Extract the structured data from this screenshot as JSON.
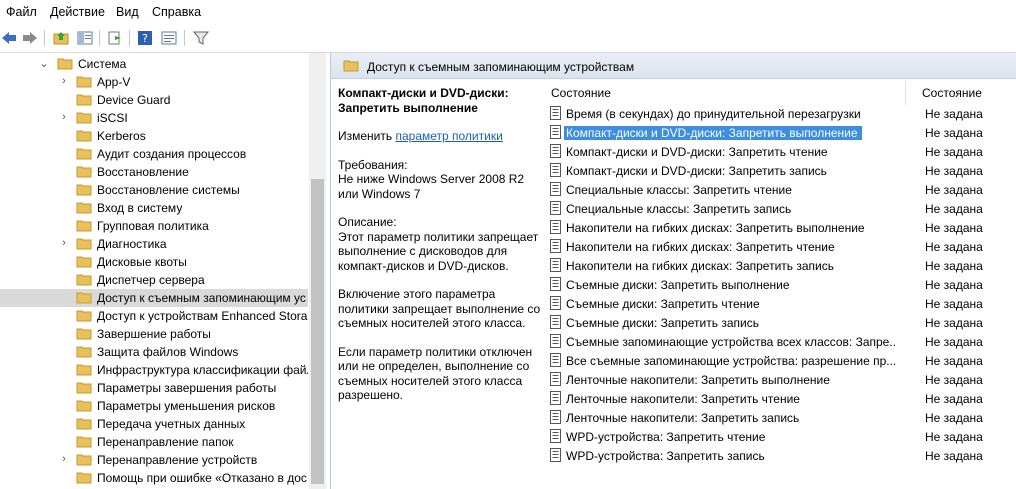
{
  "menu": [
    "Файл",
    "Действие",
    "Вид",
    "Справка"
  ],
  "tree": {
    "root": "Система",
    "items": [
      {
        "label": "App-V",
        "expandable": true
      },
      {
        "label": "Device Guard",
        "expandable": false
      },
      {
        "label": "iSCSI",
        "expandable": true
      },
      {
        "label": "Kerberos",
        "expandable": false
      },
      {
        "label": "Аудит создания процессов",
        "expandable": false
      },
      {
        "label": "Восстановление",
        "expandable": false
      },
      {
        "label": "Восстановление системы",
        "expandable": false
      },
      {
        "label": "Вход в систему",
        "expandable": false
      },
      {
        "label": "Групповая политика",
        "expandable": false
      },
      {
        "label": "Диагностика",
        "expandable": true
      },
      {
        "label": "Дисковые квоты",
        "expandable": false
      },
      {
        "label": "Диспетчер сервера",
        "expandable": false
      },
      {
        "label": "Доступ к съемным запоминающим ус",
        "expandable": false,
        "selected": true
      },
      {
        "label": "Доступ к устройствам Enhanced Storag",
        "expandable": false
      },
      {
        "label": "Завершение работы",
        "expandable": false
      },
      {
        "label": "Защита файлов Windows",
        "expandable": false
      },
      {
        "label": "Инфраструктура классификации файл",
        "expandable": false
      },
      {
        "label": "Параметры завершения работы",
        "expandable": false
      },
      {
        "label": "Параметры уменьшения рисков",
        "expandable": false
      },
      {
        "label": "Передача учетных данных",
        "expandable": false
      },
      {
        "label": "Перенаправление папок",
        "expandable": false
      },
      {
        "label": "Перенаправление устройств",
        "expandable": true
      },
      {
        "label": "Помощь при ошибке «Отказано в дос",
        "expandable": false
      }
    ]
  },
  "panel": {
    "title": "Доступ к съемным запоминающим устройствам",
    "desc_title": "Компакт-диски и DVD-диски: Запретить выполнение",
    "edit_prefix": "Изменить ",
    "edit_link": "параметр политики",
    "req_label": "Требования:",
    "req_text": "Не ниже Windows Server 2008 R2 или Windows 7",
    "desc_label": "Описание:",
    "desc_text": "Этот параметр политики запрещает выполнение с дисководов для компакт-дисков и DVD-дисков.",
    "para1": "Включение этого параметра политики запрещает выполнение со съемных носителей этого класса.",
    "para2": "Если параметр политики отключен или не определен, выполнение со съемных носителей этого класса разрешено."
  },
  "list": {
    "col_name": "Состояние",
    "col_state": "Состояние",
    "rows": [
      {
        "name": "Время (в секундах) до принудительной перезагрузки",
        "state": "Не задана"
      },
      {
        "name": "Компакт-диски и DVD-диски: Запретить выполнение",
        "state": "Не задана",
        "selected": true
      },
      {
        "name": "Компакт-диски и DVD-диски: Запретить чтение",
        "state": "Не задана"
      },
      {
        "name": "Компакт-диски и DVD-диски: Запретить запись",
        "state": "Не задана"
      },
      {
        "name": "Специальные классы: Запретить чтение",
        "state": "Не задана"
      },
      {
        "name": "Специальные классы: Запретить запись",
        "state": "Не задана"
      },
      {
        "name": "Накопители на гибких дисках: Запретить выполнение",
        "state": "Не задана"
      },
      {
        "name": "Накопители на гибких дисках: Запретить чтение",
        "state": "Не задана"
      },
      {
        "name": "Накопители на гибких дисках: Запретить запись",
        "state": "Не задана"
      },
      {
        "name": "Съемные диски: Запретить выполнение",
        "state": "Не задана"
      },
      {
        "name": "Съемные диски: Запретить чтение",
        "state": "Не задана"
      },
      {
        "name": "Съемные диски: Запретить запись",
        "state": "Не задана"
      },
      {
        "name": "Съемные запоминающие устройства всех классов: Запре...",
        "state": "Не задана"
      },
      {
        "name": "Все съемные запоминающие устройства: разрешение пр...",
        "state": "Не задана"
      },
      {
        "name": "Ленточные накопители: Запретить выполнение",
        "state": "Не задана"
      },
      {
        "name": "Ленточные накопители: Запретить чтение",
        "state": "Не задана"
      },
      {
        "name": "Ленточные накопители: Запретить запись",
        "state": "Не задана"
      },
      {
        "name": "WPD-устройства: Запретить чтение",
        "state": "Не задана"
      },
      {
        "name": "WPD-устройства: Запретить запись",
        "state": "Не задана"
      }
    ]
  },
  "colors": {
    "selection": "#3d8ee0",
    "tree_selection": "#d9d9d9",
    "folder": "#e8c15a",
    "link": "#1a5fb4"
  }
}
